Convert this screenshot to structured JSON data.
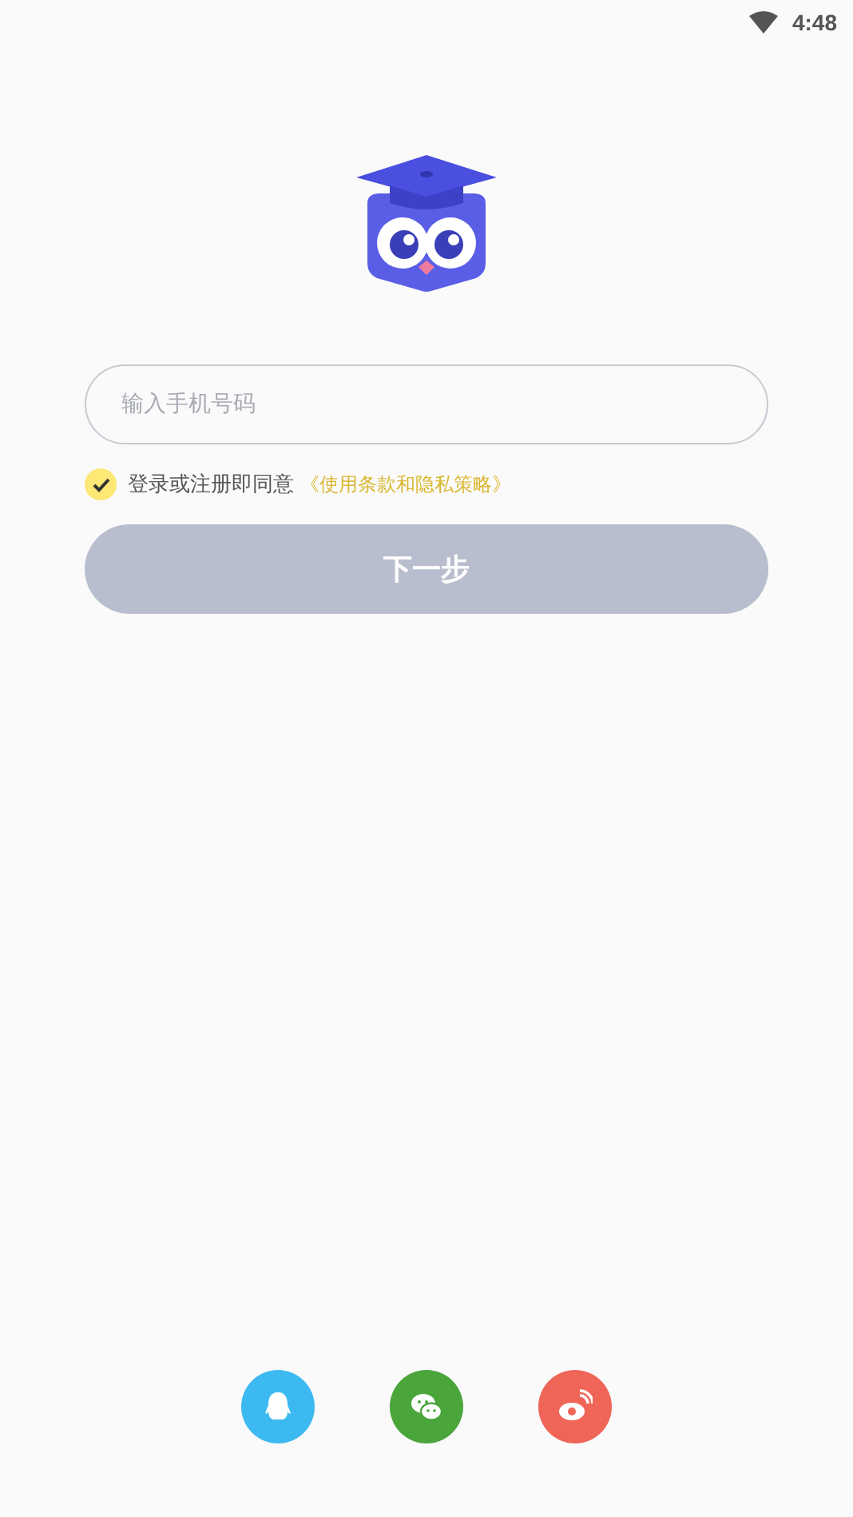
{
  "status_bar": {
    "time": "4:48"
  },
  "phone_field": {
    "placeholder": "输入手机号码"
  },
  "agreement": {
    "checked": true,
    "text": "登录或注册即同意",
    "link": "《使用条款和隐私策略》"
  },
  "next_button": {
    "label": "下一步",
    "disabled": true
  },
  "social_logins": [
    {
      "kind": "qq",
      "color": "#3cb9f0"
    },
    {
      "kind": "wechat",
      "color": "#4aa53b"
    },
    {
      "kind": "weibo",
      "color": "#ef6658"
    }
  ]
}
